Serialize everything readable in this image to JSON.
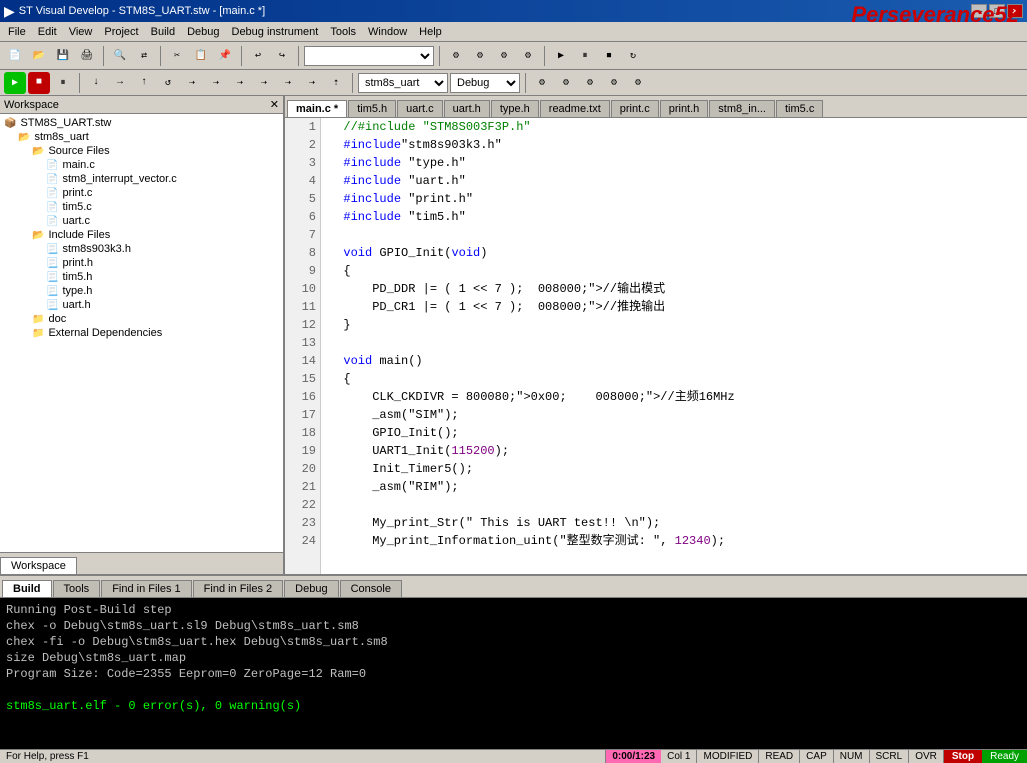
{
  "titleBar": {
    "title": "ST Visual Develop - STM8S_UART.stw - [main.c *]",
    "icon": "▶",
    "minBtn": "─",
    "maxBtn": "□",
    "closeBtn": "✕"
  },
  "watermark": "Perseverance52",
  "menuBar": {
    "items": [
      "File",
      "Edit",
      "View",
      "Project",
      "Build",
      "Debug",
      "Debug instrument",
      "Tools",
      "Window",
      "Help"
    ]
  },
  "toolbar1": {
    "combo1": "",
    "combo2": "stm8s_uart",
    "combo3": "Debug"
  },
  "sidebar": {
    "title": "Workspace",
    "closeBtn": "✕",
    "tree": [
      {
        "label": "STM8S_UART.stw",
        "indent": 0,
        "type": "project"
      },
      {
        "label": "stm8s_uart",
        "indent": 1,
        "type": "folder-open"
      },
      {
        "label": "Source Files",
        "indent": 2,
        "type": "folder-open"
      },
      {
        "label": "main.c",
        "indent": 3,
        "type": "file"
      },
      {
        "label": "stm8_interrupt_vector.c",
        "indent": 3,
        "type": "file"
      },
      {
        "label": "print.c",
        "indent": 3,
        "type": "file"
      },
      {
        "label": "tim5.c",
        "indent": 3,
        "type": "file"
      },
      {
        "label": "uart.c",
        "indent": 3,
        "type": "file"
      },
      {
        "label": "Include Files",
        "indent": 2,
        "type": "folder-open"
      },
      {
        "label": "stm8s903k3.h",
        "indent": 3,
        "type": "file-h"
      },
      {
        "label": "print.h",
        "indent": 3,
        "type": "file-h"
      },
      {
        "label": "tim5.h",
        "indent": 3,
        "type": "file-h"
      },
      {
        "label": "type.h",
        "indent": 3,
        "type": "file-h"
      },
      {
        "label": "uart.h",
        "indent": 3,
        "type": "file-h"
      },
      {
        "label": "doc",
        "indent": 2,
        "type": "folder"
      },
      {
        "label": "External Dependencies",
        "indent": 2,
        "type": "folder"
      }
    ],
    "tabLabel": "Workspace"
  },
  "editorTabs": [
    "main.c *",
    "tim5.h",
    "uart.c",
    "uart.h",
    "type.h",
    "readme.txt",
    "print.c",
    "print.h",
    "stm8_in...",
    "tim5.c"
  ],
  "codeLines": [
    {
      "num": 1,
      "text": "  //#include \"STM8S003F3P.h\"",
      "type": "comment"
    },
    {
      "num": 2,
      "text": "  #include\"stm8s903k3.h\"",
      "type": "normal"
    },
    {
      "num": 3,
      "text": "  #include \"type.h\"",
      "type": "normal"
    },
    {
      "num": 4,
      "text": "  #include \"uart.h\"",
      "type": "normal"
    },
    {
      "num": 5,
      "text": "  #include \"print.h\"",
      "type": "normal"
    },
    {
      "num": 6,
      "text": "  #include \"tim5.h\"",
      "type": "normal"
    },
    {
      "num": 7,
      "text": "",
      "type": "normal"
    },
    {
      "num": 8,
      "text": "  void GPIO_Init(void)",
      "type": "normal"
    },
    {
      "num": 9,
      "text": "  {",
      "type": "brace"
    },
    {
      "num": 10,
      "text": "      PD_DDR |= ( 1 << 7 );  //输出模式",
      "type": "normal"
    },
    {
      "num": 11,
      "text": "      PD_CR1 |= ( 1 << 7 );  //推挽输出",
      "type": "normal"
    },
    {
      "num": 12,
      "text": "  }",
      "type": "brace"
    },
    {
      "num": 13,
      "text": "",
      "type": "normal"
    },
    {
      "num": 14,
      "text": "  void main()",
      "type": "normal"
    },
    {
      "num": 15,
      "text": "  {",
      "type": "brace"
    },
    {
      "num": 16,
      "text": "      CLK_CKDIVR = 0x00;    //主频16MHz",
      "type": "normal"
    },
    {
      "num": 17,
      "text": "      _asm(\"SIM\");",
      "type": "normal"
    },
    {
      "num": 18,
      "text": "      GPIO_Init();",
      "type": "normal"
    },
    {
      "num": 19,
      "text": "      UART1_Init(115200);",
      "type": "normal"
    },
    {
      "num": 20,
      "text": "      Init_Timer5();",
      "type": "normal"
    },
    {
      "num": 21,
      "text": "      _asm(\"RIM\");",
      "type": "normal"
    },
    {
      "num": 22,
      "text": "",
      "type": "normal"
    },
    {
      "num": 23,
      "text": "      My_print_Str(\" This is UART test!! \\n\");",
      "type": "normal"
    },
    {
      "num": 24,
      "text": "      My_print_Information_uint(\"整型数字测试: \", 12340);",
      "type": "normal"
    }
  ],
  "bottomTabs": [
    "Build",
    "Tools",
    "Find in Files 1",
    "Find in Files 2",
    "Debug",
    "Console"
  ],
  "outputLines": [
    "Running Post-Build step",
    "chex -o Debug\\stm8s_uart.sl9 Debug\\stm8s_uart.sm8",
    "chex -fi -o Debug\\stm8s_uart.hex Debug\\stm8s_uart.sm8",
    "size Debug\\stm8s_uart.map",
    "Program Size: Code=2355 Eeprom=0 ZeroPage=12 Ram=0",
    "",
    "stm8s_uart.elf - 0 error(s), 0 warning(s)"
  ],
  "statusBar": {
    "hint": "For Help, press F1",
    "time": "0:00/1:23",
    "col": "Col 1",
    "modified": "MODIFIED",
    "read": "READ",
    "cap": "CAP",
    "num": "NUM",
    "scrl": "SCRL",
    "ovr": "OVR",
    "stop": "Stop",
    "ready": "Ready"
  }
}
